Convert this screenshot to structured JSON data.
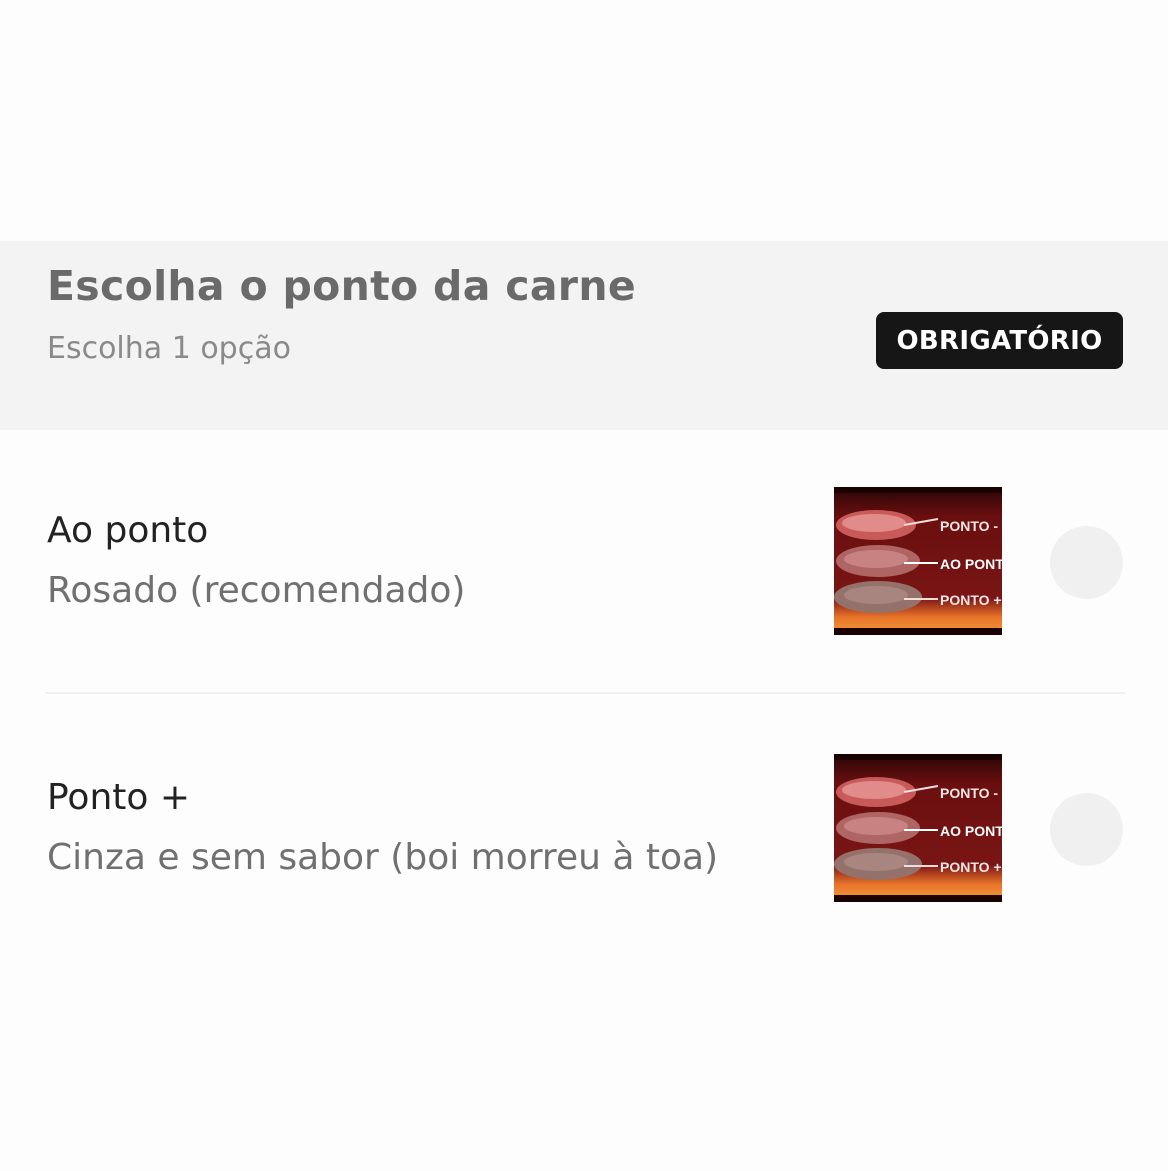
{
  "section": {
    "title": "Escolha o ponto da carne",
    "subtitle": "Escolha 1 opção",
    "badge": "OBRIGATÓRIO"
  },
  "options": [
    {
      "name": "Ao ponto",
      "description": "Rosado (recomendado)",
      "image_labels": [
        "PONTO -",
        "AO PONTO",
        "PONTO +"
      ],
      "selected": false
    },
    {
      "name": "Ponto +",
      "description": "Cinza e sem sabor (boi morreu à toa)",
      "image_labels": [
        "PONTO -",
        "AO PONTO",
        "PONTO +"
      ],
      "selected": false
    }
  ],
  "colors": {
    "header_bg": "#f3f3f3",
    "badge_bg": "#161616",
    "radio_bg": "#f0f0f0"
  }
}
